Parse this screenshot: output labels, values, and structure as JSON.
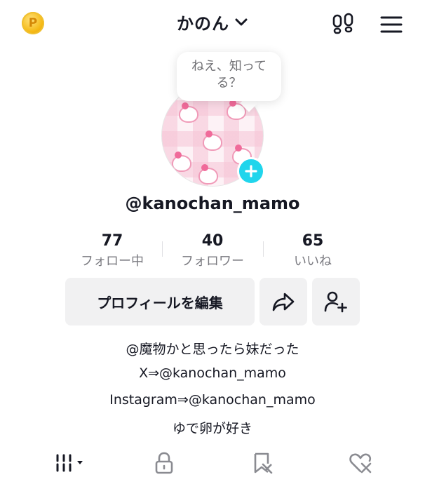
{
  "header": {
    "coin_symbol": "P",
    "account_name": "かのん"
  },
  "profile": {
    "note_bubble": "ねえ、知ってる？",
    "handle": "@kanochan_mamo"
  },
  "stats": [
    {
      "value": "77",
      "label": "フォロー中"
    },
    {
      "value": "40",
      "label": "フォロワー"
    },
    {
      "value": "65",
      "label": "いいね"
    }
  ],
  "actions": {
    "edit_profile": "プロフィールを編集"
  },
  "bio": [
    "@魔物かと思ったら妹だった",
    "X⇒@kanochan_mamo",
    "Instagram⇒@kanochan_mamo",
    "ゆで卵が好き"
  ],
  "tabs": [
    {
      "icon": "grid-icon",
      "active": true
    },
    {
      "icon": "lock-icon",
      "active": false
    },
    {
      "icon": "bookmark-off-icon",
      "active": false
    },
    {
      "icon": "heart-off-icon",
      "active": false
    }
  ],
  "colors": {
    "accent": "#20d5ec",
    "text": "#161823",
    "muted": "#7a7a80",
    "button_bg": "#f1f1f2",
    "coin": "#f5b915"
  }
}
